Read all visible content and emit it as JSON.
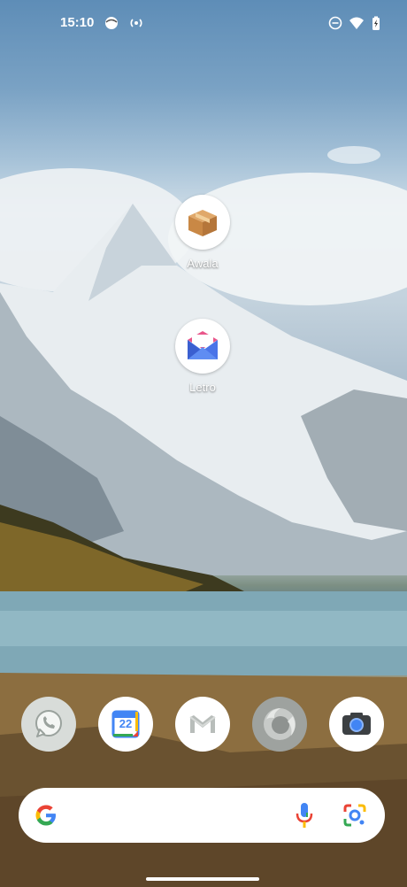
{
  "status_bar": {
    "time": "15:10",
    "left_icons": [
      "face-icon",
      "hotspot-icon"
    ],
    "right_icons": [
      "do-not-disturb-icon",
      "wifi-icon",
      "battery-icon"
    ]
  },
  "home_apps": [
    {
      "label": "Awala",
      "icon": "package-icon"
    },
    {
      "label": "Letro",
      "icon": "envelope-icon"
    }
  ],
  "dock": [
    {
      "app": "WhatsApp",
      "icon": "whatsapp-icon"
    },
    {
      "app": "Calendar",
      "icon": "calendar-icon",
      "day": "22"
    },
    {
      "app": "Gmail",
      "icon": "gmail-icon"
    },
    {
      "app": "Firefox",
      "icon": "firefox-icon"
    },
    {
      "app": "Camera",
      "icon": "camera-icon"
    }
  ],
  "search": {
    "logo": "google-g-icon",
    "voice": "microphone-icon",
    "lens": "lens-icon"
  },
  "colors": {
    "google_blue": "#4285F4",
    "google_red": "#EA4335",
    "google_yellow": "#FBBC05",
    "google_green": "#34A853"
  }
}
